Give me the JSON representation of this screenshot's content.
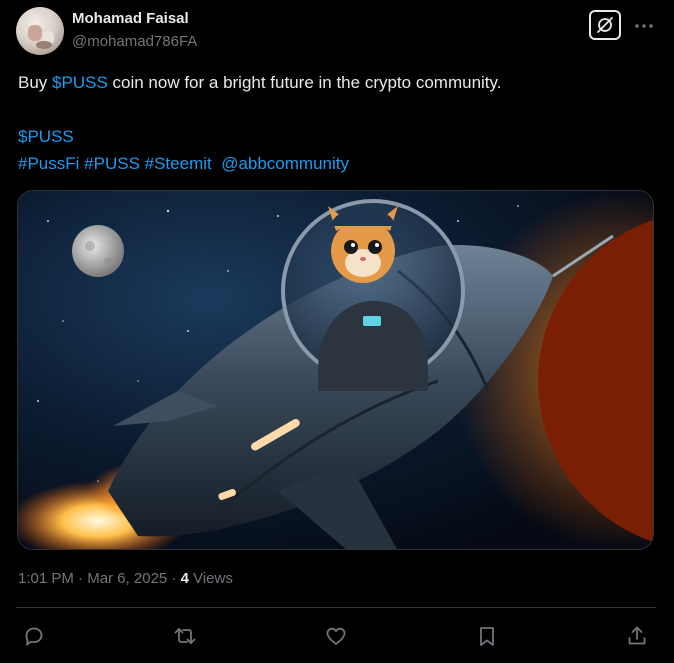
{
  "author": {
    "name": "Mohamad Faisal",
    "handle": "@mohamad786FA"
  },
  "post": {
    "text_before_link": "Buy ",
    "cashtag_inline": "$PUSS",
    "text_after_link": " coin now for a bright future in the crypto community.",
    "cashtag_line": "$PUSS",
    "hashtags": [
      "#PussFi",
      "#PUSS",
      "#Steemit"
    ],
    "mention": "@abbcommunity"
  },
  "meta": {
    "time": "1:01 PM",
    "separator": " · ",
    "date": "Mar 6, 2025",
    "views_count": "4",
    "views_label": " Views"
  },
  "icons": {
    "grok": "grok-icon",
    "more": "more-dots-icon",
    "reply": "reply-icon",
    "retweet": "retweet-icon",
    "like": "heart-icon",
    "bookmark": "bookmark-icon",
    "share": "share-icon"
  },
  "colors": {
    "background": "#000000",
    "text": "#e7e9ea",
    "secondary": "#71767b",
    "link": "#1d9bf0",
    "border": "#2f3336"
  }
}
